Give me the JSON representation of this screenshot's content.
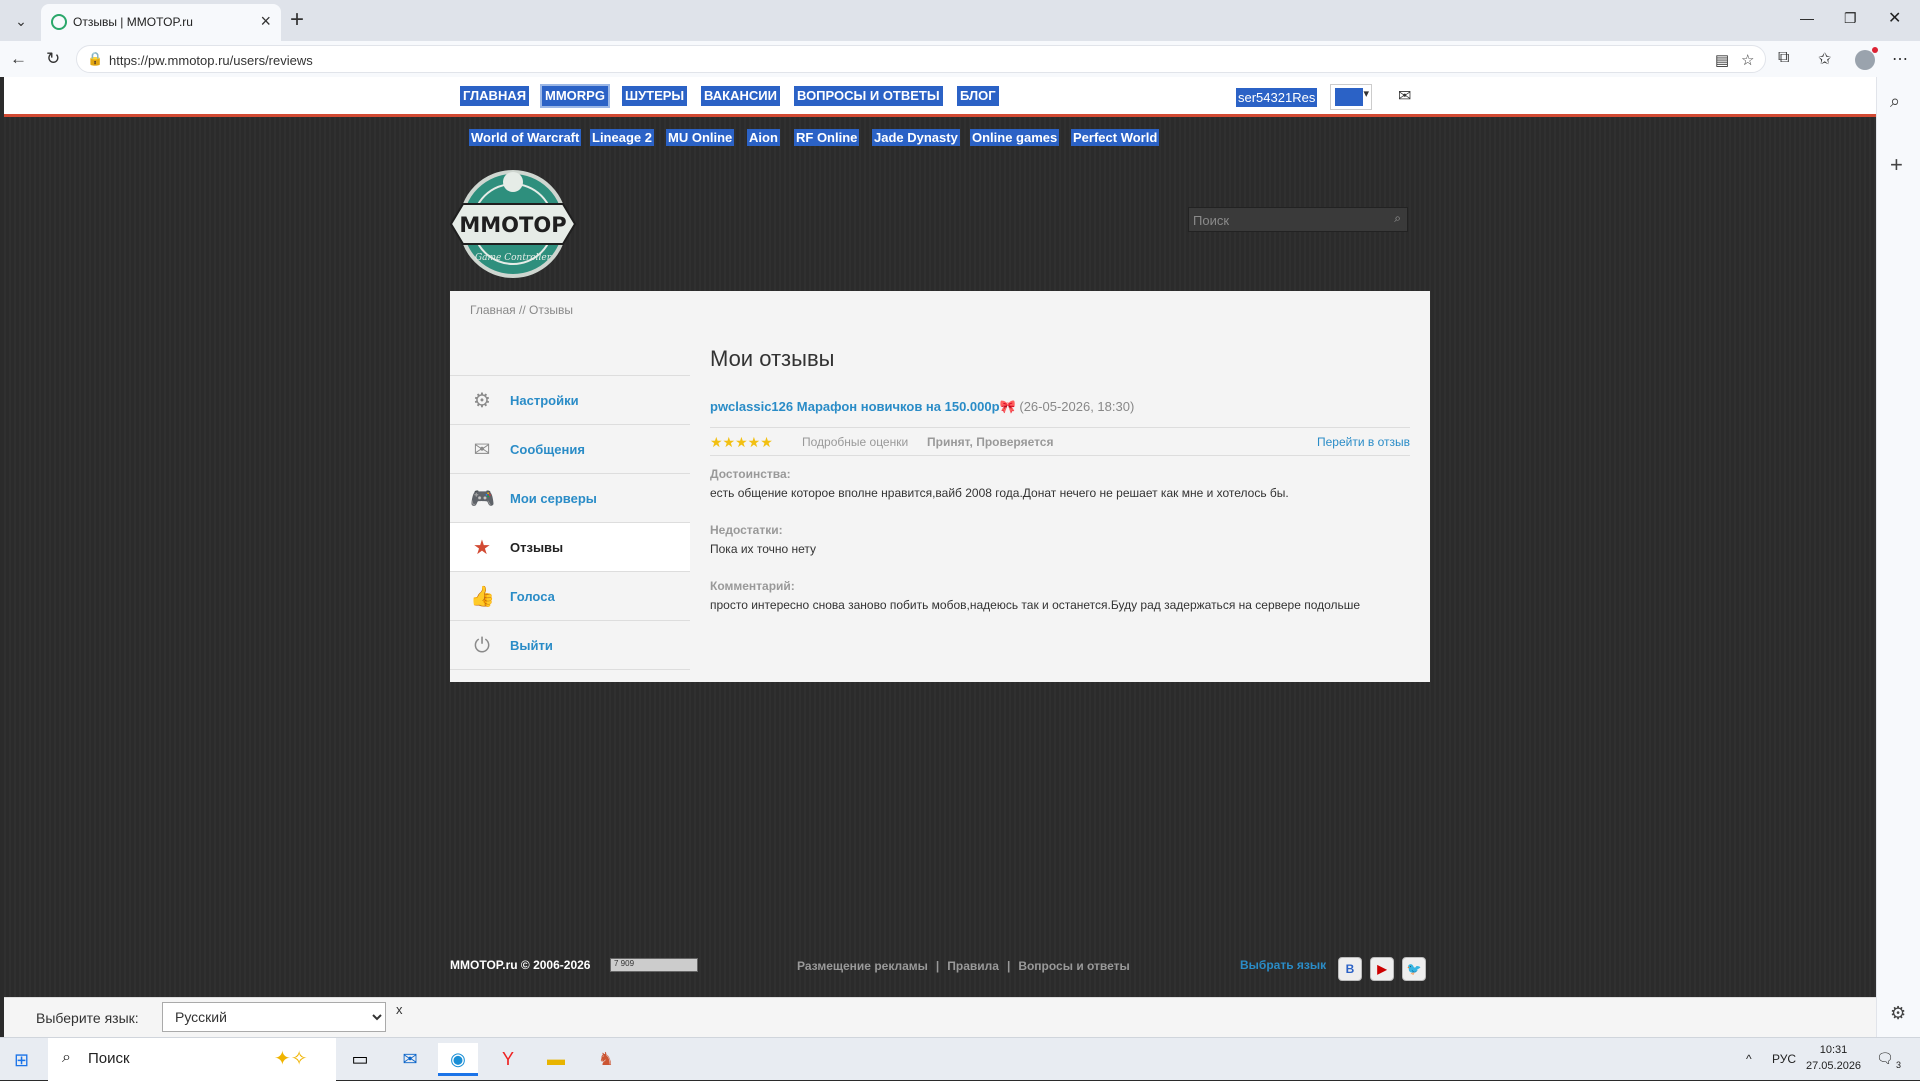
{
  "browser": {
    "tab_title": "Отзывы | MMOTOP.ru",
    "url": "https://pw.mmotop.ru/users/reviews"
  },
  "topnav": {
    "items": [
      "ГЛАВНАЯ",
      "MMORPG",
      "ШУТЕРЫ",
      "ВАКАНСИИ",
      "ВОПРОСЫ И ОТВЕТЫ",
      "БЛОГ"
    ],
    "username": "ser54321Res"
  },
  "subnav": {
    "items": [
      "World of Warcraft",
      "Lineage 2",
      "MU Online",
      "Aion",
      "RF Online",
      "Jade Dynasty",
      "Online games",
      "Perfect World"
    ]
  },
  "logo": {
    "text": "MMOTOP",
    "tagline": "Game Controller"
  },
  "search": {
    "placeholder": "Поиск"
  },
  "breadcrumb": "Главная // Отзывы",
  "menu": {
    "items": [
      {
        "label": "Настройки",
        "icon": "gear-icon"
      },
      {
        "label": "Сообщения",
        "icon": "envelope-icon"
      },
      {
        "label": "Мои серверы",
        "icon": "gamepad-icon"
      },
      {
        "label": "Отзывы",
        "icon": "star-icon",
        "active": true
      },
      {
        "label": "Голоса",
        "icon": "thumbs-up-icon"
      },
      {
        "label": "Выйти",
        "icon": "power-icon"
      }
    ]
  },
  "review": {
    "page_title": "Мои отзывы",
    "server_link": "pwclassic126 Марафон новичков на 150.000р🎀",
    "date": "(26-05-2026, 18:30)",
    "rating": 5,
    "details_label": "Подробные оценки",
    "status": "Принят, Проверяется",
    "goto_label": "Перейти в отзыв",
    "pros_label": "Достоинства:",
    "pros_text": "есть общение которое вполне нравится,вайб 2008 года.Донат нечего не решает как мне и хотелось бы.",
    "cons_label": "Недостатки:",
    "cons_text": "Пока их точно нету",
    "comment_label": "Комментарий:",
    "comment_text": "просто интересно снова заново побить мобов,надеюсь так и останется.Буду рад задержаться на сервере подольше"
  },
  "footer": {
    "copyright": "MMOTOP.ru © 2006-2026",
    "counter": "7 909",
    "links": [
      "Размещение рекламы",
      "Правила",
      "Вопросы и ответы"
    ],
    "choose_lang": "Выбрать язык"
  },
  "langbar": {
    "label": "Выберите язык:",
    "selected": "Русский",
    "close": "x"
  },
  "taskbar": {
    "search": "Поиск",
    "lang": "РУС",
    "time": "10:31",
    "date": "27.05.2026",
    "notifications": "3"
  },
  "colors": {
    "accent": "#2b62c6",
    "link": "#2a8cc7",
    "nav_border": "#d24a33",
    "star": "#f2c012"
  }
}
